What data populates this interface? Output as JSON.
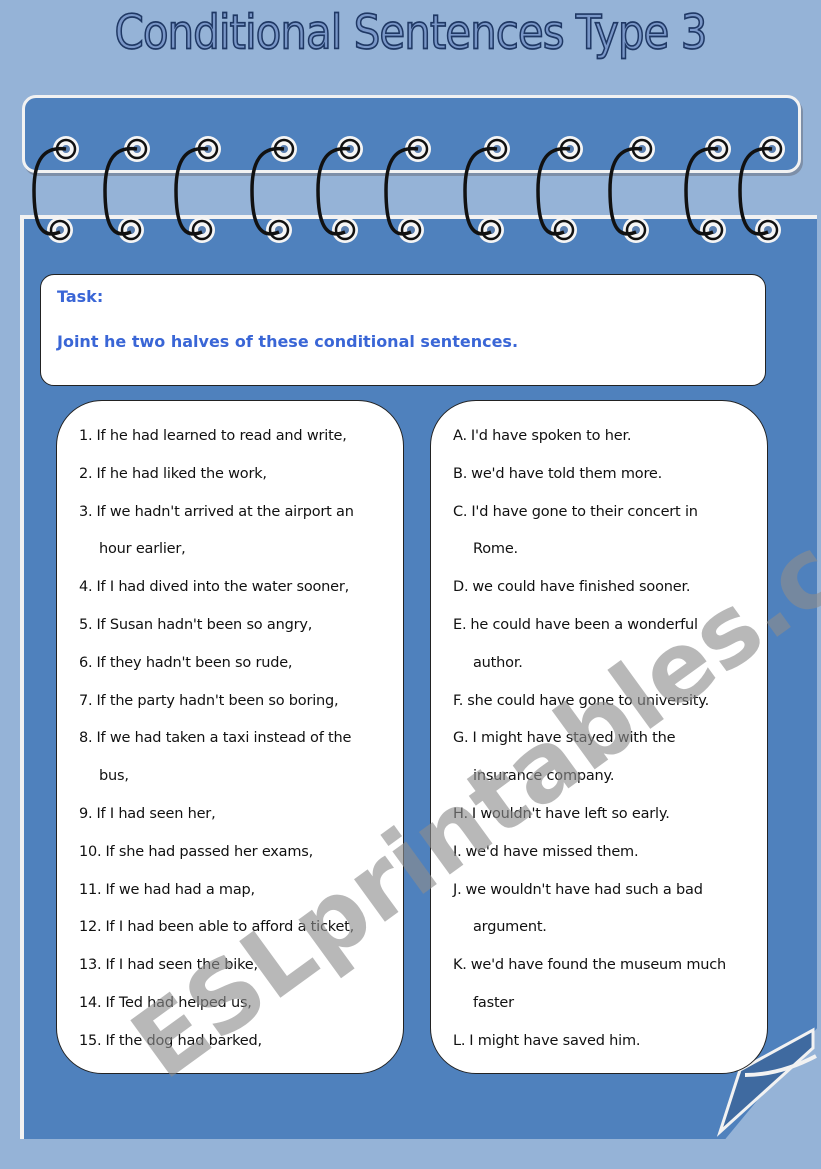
{
  "title": "Conditional Sentences Type 3",
  "task": {
    "label": "Task:",
    "instruction": "Joint he two halves of these conditional sentences."
  },
  "left_items": [
    {
      "num": "1.",
      "text": "If he had learned to read and write,",
      "cont": ""
    },
    {
      "num": "2.",
      "text": "If he had liked the work,",
      "cont": ""
    },
    {
      "num": "3.",
      "text": "If we hadn't arrived at the airport an",
      "cont": "hour earlier,"
    },
    {
      "num": "4.",
      "text": "If I had dived into the water sooner,",
      "cont": ""
    },
    {
      "num": "5.",
      "text": "If Susan hadn't been so angry,",
      "cont": ""
    },
    {
      "num": "6.",
      "text": "If they hadn't been so rude,",
      "cont": ""
    },
    {
      "num": "7.",
      "text": "If the party hadn't been so boring,",
      "cont": ""
    },
    {
      "num": "8.",
      "text": "If we had taken a taxi instead of the",
      "cont": "bus,"
    },
    {
      "num": "9.",
      "text": "If I had seen her,",
      "cont": ""
    },
    {
      "num": "10.",
      "text": "If she had passed her exams,",
      "cont": ""
    },
    {
      "num": "11.",
      "text": "If we had had a map,",
      "cont": ""
    },
    {
      "num": "12.",
      "text": "If I had been able to afford a ticket,",
      "cont": ""
    },
    {
      "num": "13.",
      "text": "If I had seen the bike,",
      "cont": ""
    },
    {
      "num": "14.",
      "text": "If Ted had helped us,",
      "cont": ""
    },
    {
      "num": "15.",
      "text": "If the dog had barked,",
      "cont": ""
    }
  ],
  "right_items": [
    {
      "num": "A.",
      "text": "I'd have spoken to her.",
      "cont": ""
    },
    {
      "num": "B.",
      "text": "we'd have told them more.",
      "cont": ""
    },
    {
      "num": "C.",
      "text": "I'd have gone to their concert in",
      "cont": "Rome."
    },
    {
      "num": "D.",
      "text": "we could have finished sooner.",
      "cont": ""
    },
    {
      "num": "E.",
      "text": "he could have been a wonderful",
      "cont": "author."
    },
    {
      "num": "F.",
      "text": "she could have gone to university.",
      "cont": ""
    },
    {
      "num": "G.",
      "text": "I might have stayed with the",
      "cont": "insurance company."
    },
    {
      "num": "H.",
      "text": "I wouldn't have left so early.",
      "cont": ""
    },
    {
      "num": "I.",
      "text": "we'd have missed them.",
      "cont": ""
    },
    {
      "num": "J.",
      "text": "we wouldn't have had such a bad",
      "cont": "argument."
    },
    {
      "num": "K.",
      "text": "we'd have found the museum much",
      "cont": "faster"
    },
    {
      "num": "L.",
      "text": "I might have saved him.",
      "cont": ""
    }
  ],
  "watermark": "ESLprintables.com",
  "colors": {
    "background": "#95b3d7",
    "panel": "#4f81bd",
    "task_text": "#3a66d6",
    "watermark": "#8c8c8c"
  },
  "spiral_ring_count": 11
}
